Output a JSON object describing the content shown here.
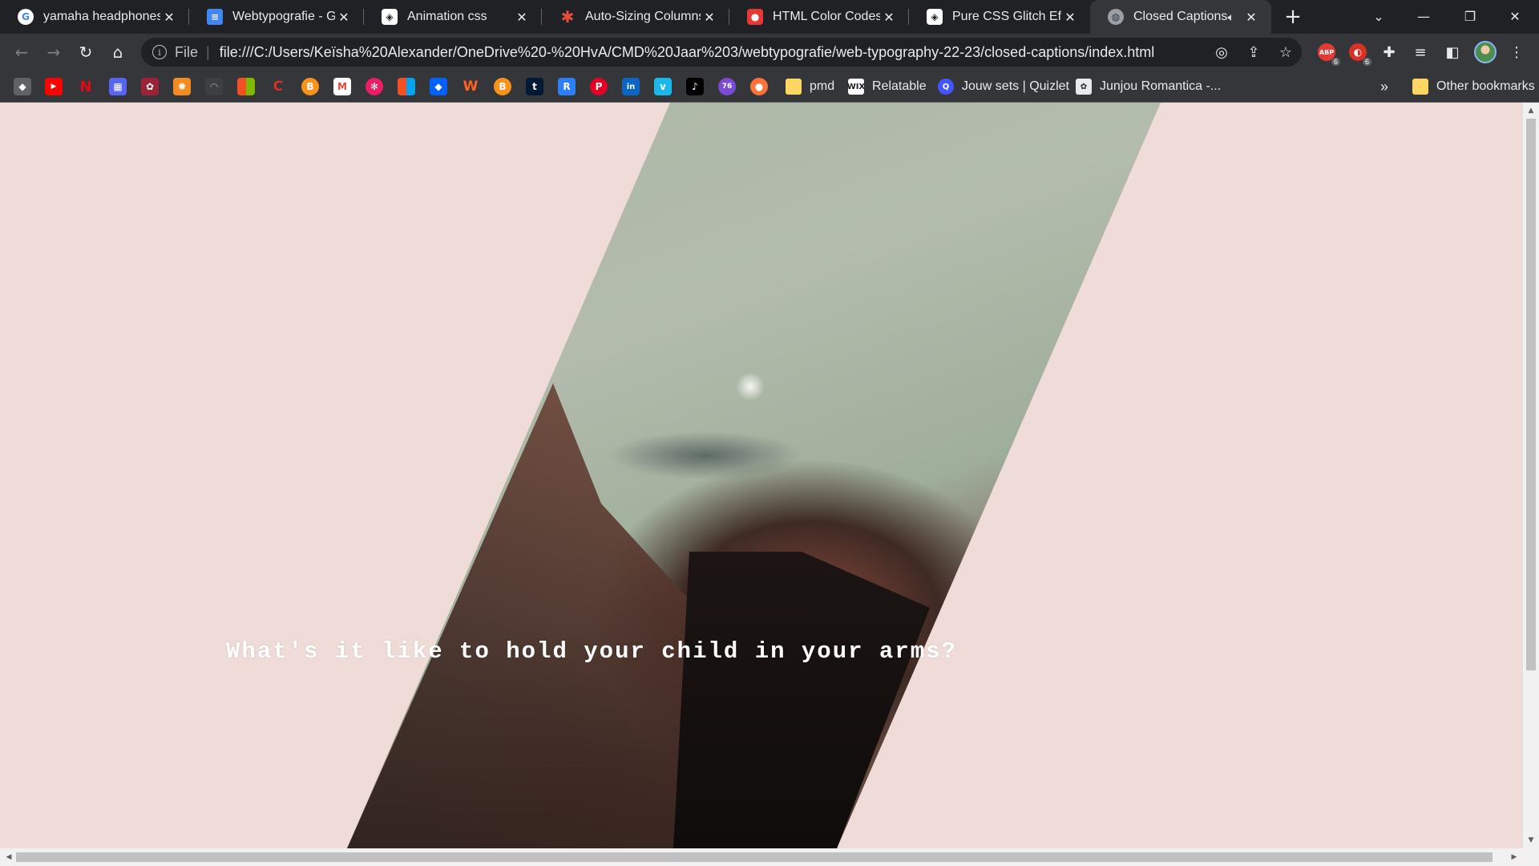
{
  "browser": {
    "tabs": [
      {
        "title": "yamaha headphones",
        "favicon": "google-icon",
        "color": "#ffffff"
      },
      {
        "title": "Webtypografie - Goo",
        "favicon": "google-docs-icon",
        "color": "#4285f4"
      },
      {
        "title": "Animation css",
        "favicon": "codepen-icon",
        "color": "#ffffff"
      },
      {
        "title": "Auto-Sizing Columns",
        "favicon": "asterisk-icon",
        "color": "#e84c3d"
      },
      {
        "title": "HTML Color Codes",
        "favicon": "color-codes-icon",
        "color": "#e53935"
      },
      {
        "title": "Pure CSS Glitch Effect",
        "favicon": "codepen-icon",
        "color": "#ffffff"
      },
      {
        "title": "Closed Captions",
        "favicon": "globe-icon",
        "color": "#9aa0a6"
      }
    ],
    "new_tab": "+",
    "close_glyph": "✕",
    "window": {
      "minimize": "—",
      "restore": "❐",
      "close": "✕",
      "tab_search": "⌄"
    }
  },
  "toolbar": {
    "back": "←",
    "forward": "→",
    "reload": "↻",
    "home": "⌂",
    "info": "i",
    "scheme_label": "File",
    "url": "file:///C:/Users/Keïsha%20Alexander/OneDrive%20-%20HvA/CMD%20Jaar%203/webtypografie/web-typography-22-23/closed-captions/index.html",
    "badges": {
      "adblock": "6",
      "extension2": "6"
    }
  },
  "bookmarks": {
    "labeled": [
      {
        "label": "pmd",
        "icon": "folder-icon",
        "color": "#fdd663"
      },
      {
        "label": "Relatable",
        "icon": "wix-icon",
        "color": "#ffffff"
      },
      {
        "label": "Jouw sets | Quizlet",
        "icon": "quizlet-icon",
        "color": "#4255ff"
      },
      {
        "label": "Junjou Romantica -...",
        "icon": "anime-icon",
        "color": "#e8eaed"
      }
    ],
    "overflow": "»",
    "other": "Other bookmarks",
    "icon_only": [
      {
        "icon": "layers-icon",
        "color": "#9aa0a6",
        "glyph": "◆"
      },
      {
        "icon": "youtube-icon",
        "color": "#ff0000",
        "glyph": "▶"
      },
      {
        "icon": "netflix-icon",
        "color": "#e50914",
        "glyph": "N"
      },
      {
        "icon": "building-icon",
        "color": "#5865f2",
        "glyph": "▦"
      },
      {
        "icon": "crest-icon",
        "color": "#9b2335",
        "glyph": "✿"
      },
      {
        "icon": "sunburst-icon",
        "color": "#f28b22",
        "glyph": "✺"
      },
      {
        "icon": "wifi-icon",
        "color": "#3c4043",
        "glyph": "◠"
      },
      {
        "icon": "microsoft-icon",
        "color": "#00a4ef",
        "glyph": "■"
      },
      {
        "icon": "refresh-red-icon",
        "color": "#d93025",
        "glyph": "C"
      },
      {
        "icon": "bitcoin-icon",
        "color": "#f7931a",
        "glyph": "B"
      },
      {
        "icon": "gmail-icon",
        "color": "#ea4335",
        "glyph": "M"
      },
      {
        "icon": "pinwheel-icon",
        "color": "#e91e63",
        "glyph": "✻"
      },
      {
        "icon": "windows-icon",
        "color": "#f25022",
        "glyph": "■"
      },
      {
        "icon": "dropbox-icon",
        "color": "#0061ff",
        "glyph": "◆"
      },
      {
        "icon": "wattpad-icon",
        "color": "#ff6122",
        "glyph": "W"
      },
      {
        "icon": "bitcoin2-icon",
        "color": "#f7931a",
        "glyph": "B"
      },
      {
        "icon": "tumblr-icon",
        "color": "#001935",
        "glyph": "t"
      },
      {
        "icon": "r-icon",
        "color": "#2d7ff9",
        "glyph": "R"
      },
      {
        "icon": "pinterest-icon",
        "color": "#e60023",
        "glyph": "P"
      },
      {
        "icon": "linkedin-icon",
        "color": "#0a66c2",
        "glyph": "in"
      },
      {
        "icon": "vimeo-icon",
        "color": "#1ab7ea",
        "glyph": "v"
      },
      {
        "icon": "tiktok-icon",
        "color": "#000000",
        "glyph": "♪"
      },
      {
        "icon": "76-icon",
        "color": "#7b4bd6",
        "glyph": "76"
      },
      {
        "icon": "fox-icon",
        "color": "#ff7139",
        "glyph": "●"
      }
    ]
  },
  "page": {
    "caption": "What's it like to hold your child in your arms?",
    "background": "#efdcd9"
  }
}
